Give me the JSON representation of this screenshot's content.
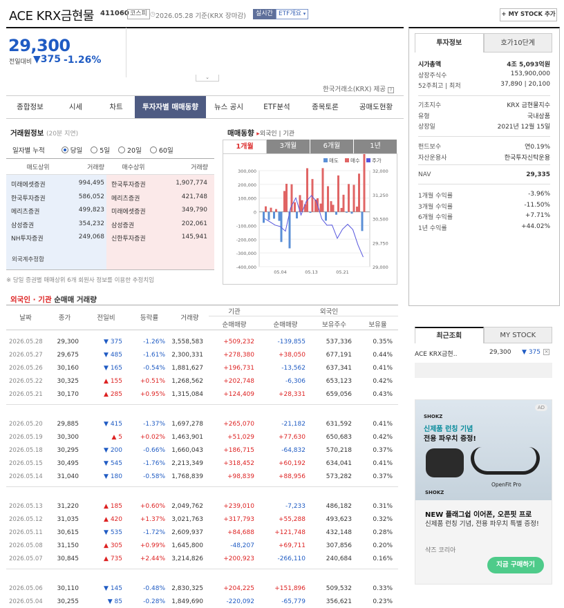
{
  "header": {
    "title": "ACE KRX금현물",
    "code": "411060",
    "market_badge": "코스피",
    "date_text": "2026.05.28 기준(KRX 장마감)",
    "realtime_badge": "실시간",
    "etf_badge": "ETF개요",
    "mystock_button": "+ MY STOCK 추가"
  },
  "price": {
    "current": "29,300",
    "change_label": "전일대비",
    "change": "▼375",
    "change_pct": "-1.26%"
  },
  "krx_note": "한국거래소(KRX) 제공",
  "tabs": [
    "종합정보",
    "시세",
    "차트",
    "투자자별 매매동향",
    "뉴스 공시",
    "ETF분석",
    "종목토론",
    "공매도현황"
  ],
  "active_tab": 3,
  "broker": {
    "title": "거래원정보",
    "sub": "(20분 지연)",
    "period_label": "일자별 누적",
    "options": [
      "당일",
      "5일",
      "20일",
      "60일"
    ],
    "selected_option": 0,
    "headers": [
      "매도상위",
      "거래량",
      "매수상위",
      "거래량"
    ],
    "rows": [
      [
        "미래에셋증권",
        "994,495",
        "한국투자증권",
        "1,907,774"
      ],
      [
        "한국투자증권",
        "586,052",
        "메리츠증권",
        "421,748"
      ],
      [
        "메리츠증권",
        "499,823",
        "미래에셋증권",
        "349,790"
      ],
      [
        "삼성증권",
        "354,232",
        "삼성증권",
        "202,061"
      ],
      [
        "NH투자증권",
        "249,068",
        "신한투자증권",
        "145,941"
      ]
    ],
    "foreign_label": "외국계추정합",
    "note": "※ 당일 증권별 매매상위 6개 회원사 정보를 이용한 추정치임"
  },
  "trend": {
    "title": "매매동향",
    "filter1": "외국인",
    "filter2": "기관",
    "periods": [
      "1개월",
      "3개월",
      "6개월",
      "1년"
    ],
    "active_period": 0
  },
  "chart_data": {
    "type": "bar",
    "title": "",
    "legend": [
      "매도",
      "매수",
      "주가"
    ],
    "legend_colors": [
      "#5b8fd6",
      "#e06565",
      "#5555dd"
    ],
    "x_ticks": [
      "05.04",
      "05.13",
      "05.21"
    ],
    "y_left": {
      "min": -400000,
      "max": 300000,
      "ticks": [
        "300,000",
        "200,000",
        "100,000",
        "0",
        "-100,000",
        "-200,000",
        "-300,000",
        "-400,000"
      ]
    },
    "y_right": {
      "min": 29000,
      "max": 32000,
      "ticks": [
        "32,000",
        "31,250",
        "30,500",
        "29,750",
        "29,000"
      ]
    },
    "dates": [
      "04.28",
      "04.29",
      "04.30",
      "05.04",
      "05.06",
      "05.07",
      "05.08",
      "05.11",
      "05.12",
      "05.13",
      "05.14",
      "05.15",
      "05.18",
      "05.19",
      "05.20",
      "05.21",
      "05.22",
      "05.26",
      "05.27",
      "05.28"
    ],
    "foreign": [
      -80000,
      -60000,
      -50000,
      -65779,
      151896,
      -266110,
      69711,
      121748,
      55288,
      -7233,
      88956,
      60192,
      -64832,
      77630,
      -21182,
      28331,
      -6306,
      -13562,
      38050,
      -139855
    ],
    "institution": [
      40000,
      30000,
      20000,
      -220092,
      204225,
      200923,
      -48207,
      84688,
      317793,
      239010,
      98839,
      318452,
      186715,
      51029,
      265070,
      124409,
      202748,
      196731,
      278380,
      509232
    ],
    "close": [
      30500,
      30400,
      30300,
      30255,
      30110,
      30845,
      31150,
      30615,
      31035,
      31220,
      31040,
      30495,
      30295,
      30300,
      29885,
      30170,
      30325,
      30160,
      29675,
      29300
    ]
  },
  "netbuy": {
    "title_a": "외국인 · 기관",
    "title_b": " 순매매 거래량",
    "group_inst": "기관",
    "group_foreign": "외국인",
    "headers": [
      "날짜",
      "종가",
      "전일비",
      "등락률",
      "거래량",
      "순매매량",
      "순매매량",
      "보유주수",
      "보유율"
    ],
    "groups": [
      [
        [
          "2026.05.28",
          "29,300",
          "▼ 375",
          "-1.26%",
          "3,558,583",
          "+509,232",
          "-139,855",
          "537,336",
          "0.35%"
        ],
        [
          "2026.05.27",
          "29,675",
          "▼ 485",
          "-1.61%",
          "2,300,331",
          "+278,380",
          "+38,050",
          "677,191",
          "0.44%"
        ],
        [
          "2026.05.26",
          "30,160",
          "▼ 165",
          "-0.54%",
          "1,881,627",
          "+196,731",
          "-13,562",
          "637,341",
          "0.41%"
        ],
        [
          "2026.05.22",
          "30,325",
          "▲ 155",
          "+0.51%",
          "1,268,562",
          "+202,748",
          "-6,306",
          "653,123",
          "0.42%"
        ],
        [
          "2026.05.21",
          "30,170",
          "▲ 285",
          "+0.95%",
          "1,315,084",
          "+124,409",
          "+28,331",
          "659,056",
          "0.43%"
        ]
      ],
      [
        [
          "2026.05.20",
          "29,885",
          "▼ 415",
          "-1.37%",
          "1,697,278",
          "+265,070",
          "-21,182",
          "631,592",
          "0.41%"
        ],
        [
          "2026.05.19",
          "30,300",
          "▲ 5",
          "+0.02%",
          "1,463,901",
          "+51,029",
          "+77,630",
          "650,683",
          "0.42%"
        ],
        [
          "2026.05.18",
          "30,295",
          "▼ 200",
          "-0.66%",
          "1,660,043",
          "+186,715",
          "-64,832",
          "570,218",
          "0.37%"
        ],
        [
          "2026.05.15",
          "30,495",
          "▼ 545",
          "-1.76%",
          "2,213,349",
          "+318,452",
          "+60,192",
          "634,041",
          "0.41%"
        ],
        [
          "2026.05.14",
          "31,040",
          "▼ 180",
          "-0.58%",
          "1,768,839",
          "+98,839",
          "+88,956",
          "573,282",
          "0.37%"
        ]
      ],
      [
        [
          "2026.05.13",
          "31,220",
          "▲ 185",
          "+0.60%",
          "2,049,762",
          "+239,010",
          "-7,233",
          "486,182",
          "0.31%"
        ],
        [
          "2026.05.12",
          "31,035",
          "▲ 420",
          "+1.37%",
          "3,021,763",
          "+317,793",
          "+55,288",
          "493,623",
          "0.32%"
        ],
        [
          "2026.05.11",
          "30,615",
          "▼ 535",
          "-1.72%",
          "2,609,937",
          "+84,688",
          "+121,748",
          "432,148",
          "0.28%"
        ],
        [
          "2026.05.08",
          "31,150",
          "▲ 305",
          "+0.99%",
          "1,645,800",
          "-48,207",
          "+69,711",
          "307,856",
          "0.20%"
        ],
        [
          "2026.05.07",
          "30,845",
          "▲ 735",
          "+2.44%",
          "3,214,826",
          "+200,923",
          "-266,110",
          "240,684",
          "0.16%"
        ]
      ],
      [
        [
          "2026.05.06",
          "30,110",
          "▼ 145",
          "-0.48%",
          "2,830,325",
          "+204,225",
          "+151,896",
          "509,532",
          "0.33%"
        ],
        [
          "2026.05.04",
          "30,255",
          "▼ 85",
          "-0.28%",
          "1,849,690",
          "-220,092",
          "-65,779",
          "356,621",
          "0.23%"
        ]
      ]
    ]
  },
  "invest_info": {
    "tabs": [
      "투자정보",
      "호가10단계"
    ],
    "rows1": [
      [
        "시가총액",
        "4조 5,093억원"
      ],
      [
        "상장주식수",
        "153,900,000"
      ],
      [
        "52주최고 | 최저",
        "37,890 | 20,100"
      ]
    ],
    "rows2": [
      [
        "기초지수",
        "KRX 금현물지수"
      ],
      [
        "유형",
        "국내상품"
      ],
      [
        "상장일",
        "2021년 12월 15일"
      ]
    ],
    "rows3": [
      [
        "펀드보수",
        "연0.19%"
      ],
      [
        "자산운용사",
        "한국투자신탁운용"
      ]
    ],
    "nav_label": "NAV",
    "nav_value": "29,335",
    "returns": [
      [
        "1개월 수익률",
        "-3.96%"
      ],
      [
        "3개월 수익률",
        "-11.50%"
      ],
      [
        "6개월 수익률",
        "+7.71%"
      ],
      [
        "1년 수익률",
        "+44.02%"
      ]
    ]
  },
  "recent": {
    "tabs": [
      "최근조회",
      "MY STOCK"
    ],
    "item_name": "ACE KRX금현..",
    "item_price": "29,300",
    "item_change": "▼ 375"
  },
  "ad": {
    "badge": "AD",
    "brand": "SHOKZ",
    "headline1": "신제품 런칭 기념",
    "headline2": "전용 파우치 증정!",
    "product": "OpenFit Pro",
    "title": "NEW 플래그쉽 이어폰, 오픈핏 프로",
    "desc": "신제품 런칭 기념, 전용 파우치 특별 증정!",
    "advertiser": "샥즈 코리아",
    "cta": "지금 구매하기"
  }
}
